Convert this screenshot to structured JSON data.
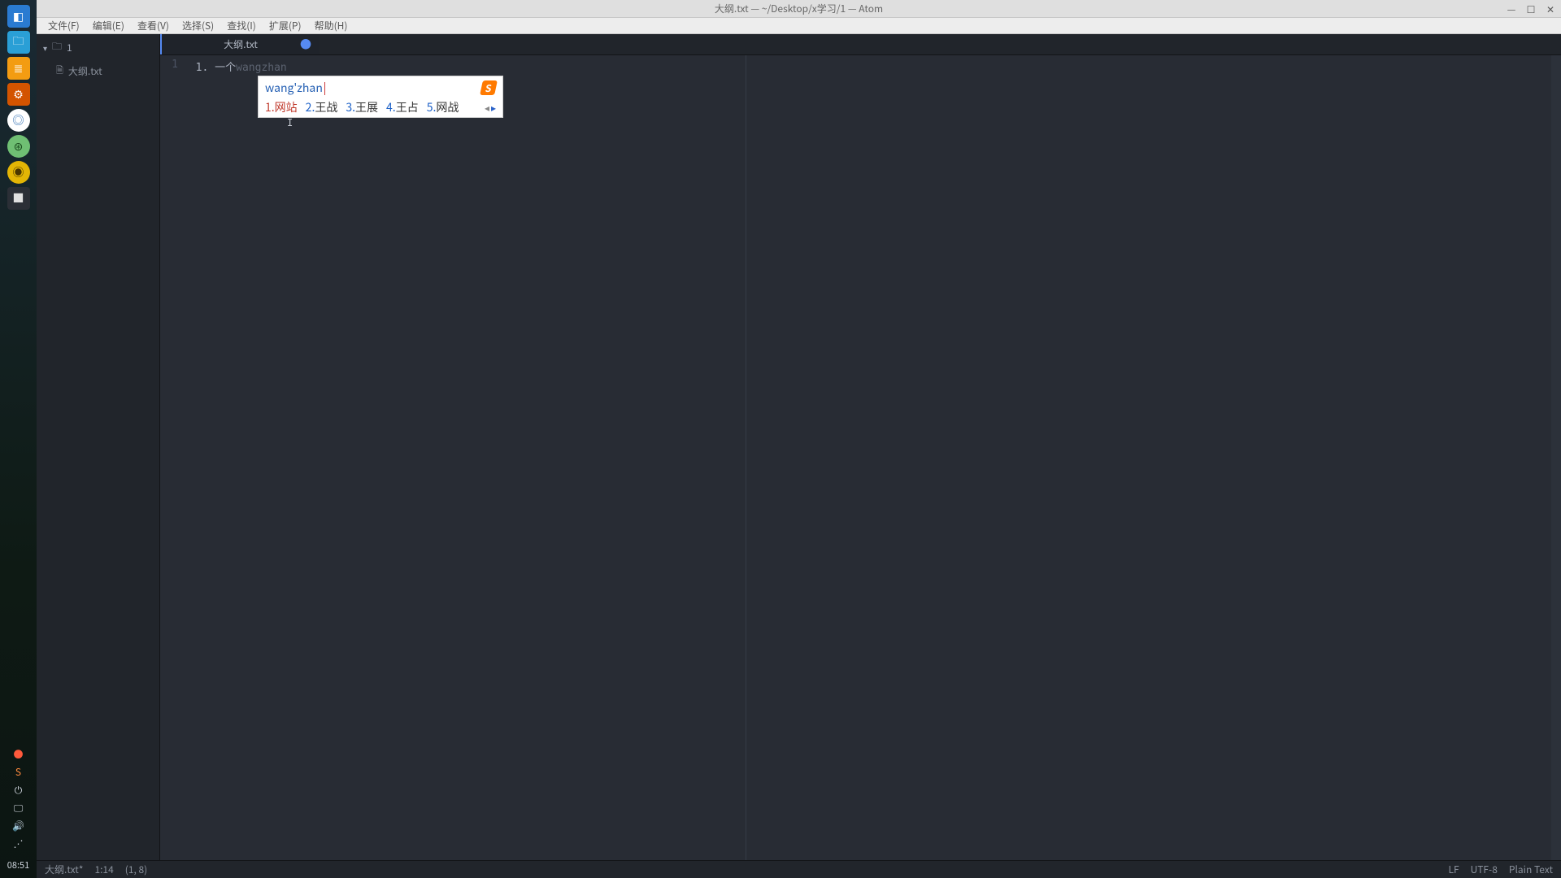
{
  "window": {
    "title": "大纲.txt — ~/Desktop/x学习/1 — Atom"
  },
  "menu": {
    "file": "文件(F)",
    "edit": "编辑(E)",
    "view": "查看(V)",
    "select": "选择(S)",
    "find": "查找(I)",
    "packages": "扩展(P)",
    "help": "帮助(H)"
  },
  "tree": {
    "root": "1",
    "file": "大纲.txt"
  },
  "tabs": {
    "active": "大纲.txt",
    "modified_glyph": "●"
  },
  "editor": {
    "gutter_1": "1",
    "line1_prefix": "  1. 一个",
    "line1_ghost": "wangzhan"
  },
  "ime": {
    "input": "wang'zhan",
    "brand": "S",
    "candidates": [
      {
        "idx": "1.",
        "text": "网站"
      },
      {
        "idx": "2.",
        "text": "王战"
      },
      {
        "idx": "3.",
        "text": "王展"
      },
      {
        "idx": "4.",
        "text": "王占"
      },
      {
        "idx": "5.",
        "text": "网战"
      }
    ],
    "prev": "◂",
    "next": "▸"
  },
  "statusbar": {
    "file": "大纲.txt*",
    "pos_short": "1:14",
    "pos_paren": "(1, 8)",
    "line_ending": "LF",
    "encoding": "UTF-8",
    "grammar": "Plain Text"
  },
  "dock": {
    "clock": "08:51"
  }
}
